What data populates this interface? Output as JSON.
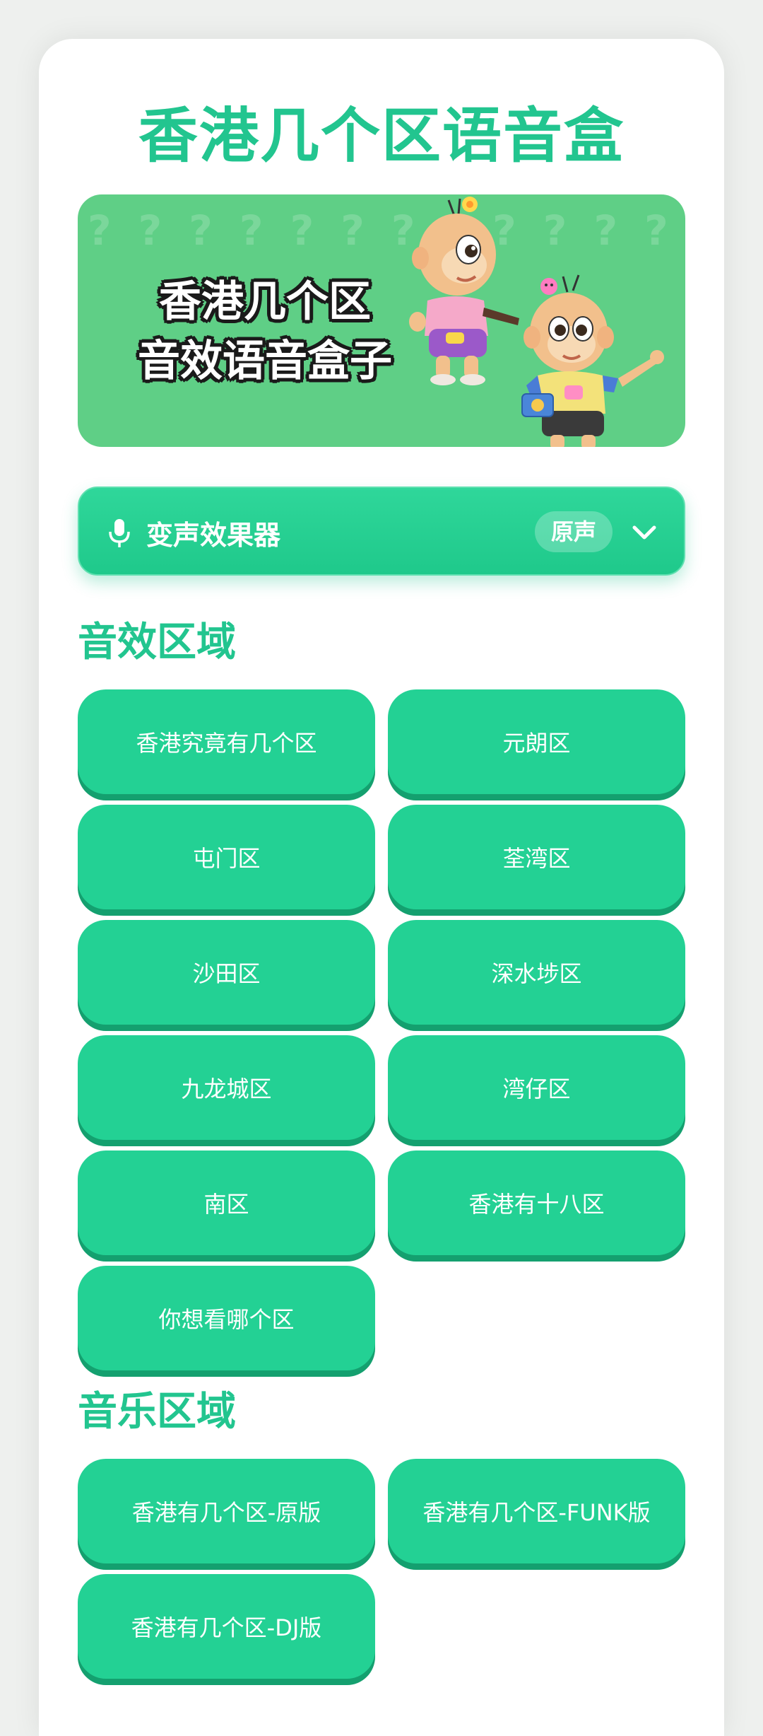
{
  "page": {
    "title": "香港几个区语音盒"
  },
  "banner": {
    "line1": "香港几个区",
    "line2": "音效语音盒子",
    "pattern": "????????????????????????????????????????????????????????????????????????????????????????"
  },
  "voice_changer": {
    "label": "变声效果器",
    "selected": "原声",
    "icons": [
      "mic-icon",
      "chevron-down-icon"
    ]
  },
  "sound_section": {
    "title": "音效区域",
    "buttons": [
      "香港究竟有几个区",
      "元朗区",
      "屯门区",
      "荃湾区",
      "沙田区",
      "深水埗区",
      "九龙城区",
      "湾仔区",
      "南区",
      "香港有十八区",
      "你想看哪个区"
    ]
  },
  "music_section": {
    "title": "音乐区域",
    "buttons": [
      "香港有几个区-原版",
      "香港有几个区-FUNK版",
      "香港有几个区-DJ版"
    ]
  },
  "colors": {
    "accent": "#22c58f",
    "button": "#23d194",
    "button_shadow": "#14a06f",
    "banner_bg": "#5fcf86"
  }
}
